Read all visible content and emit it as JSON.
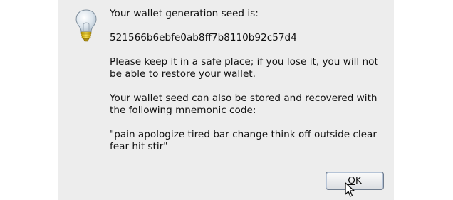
{
  "dialog": {
    "icon": "lightbulb-icon",
    "lines": {
      "seed_intro": "Your wallet generation seed is:",
      "seed_value": "521566b6ebfe0ab8ff7b8110b92c57d4",
      "warning": "Please keep it in a safe place; if you lose it, you will not be able to restore your wallet.",
      "mnemonic_intro": "Your wallet seed can also be stored and recovered with the following mnemonic code:",
      "mnemonic_value": "\"pain apologize tired bar change think off outside clear fear hit stir\""
    },
    "ok_button": {
      "mnemonic_letter": "O",
      "rest": "K"
    }
  },
  "colors": {
    "dialog_bg": "#ededed",
    "button_border": "#6f7c8e"
  }
}
